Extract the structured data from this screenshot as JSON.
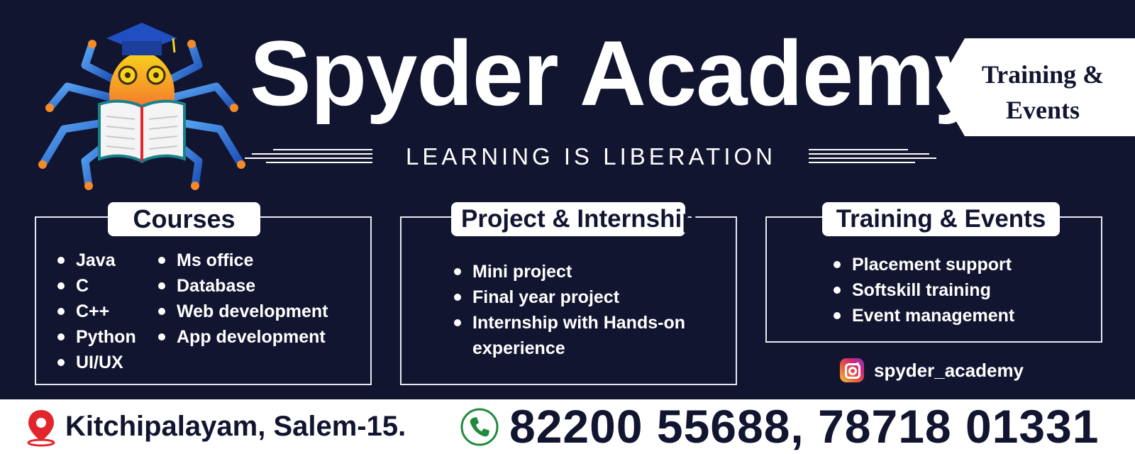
{
  "brand": {
    "title": "Spyder Academy",
    "tagline": "LEARNING IS LIBERATION",
    "ribbon_line1": "Training &",
    "ribbon_line2": "Events"
  },
  "sections": {
    "courses": {
      "title": "Courses",
      "col1": [
        "Java",
        "C",
        "C++",
        "Python",
        "UI/UX"
      ],
      "col2": [
        "Ms office",
        "Database",
        "Web development",
        "App development"
      ]
    },
    "projects": {
      "title": "Project & Internship",
      "items": [
        "Mini project",
        "Final year project",
        "Internship with Hands-on",
        "experience"
      ]
    },
    "training": {
      "title": "Training & Events",
      "items": [
        "Placement support",
        "Softskill training",
        "Event management"
      ]
    }
  },
  "social": {
    "icon": "instagram-icon",
    "handle": "spyder_academy"
  },
  "footer": {
    "address": "Kitchipalayam, Salem-15.",
    "phones": "82200 55688, 78718 01331",
    "location_icon": "location-pin-icon",
    "phone_icon": "phone-icon"
  },
  "colors": {
    "background": "#111530",
    "text": "#ffffff",
    "pin": "#e3262b",
    "phone_green": "#1f8a3d"
  }
}
